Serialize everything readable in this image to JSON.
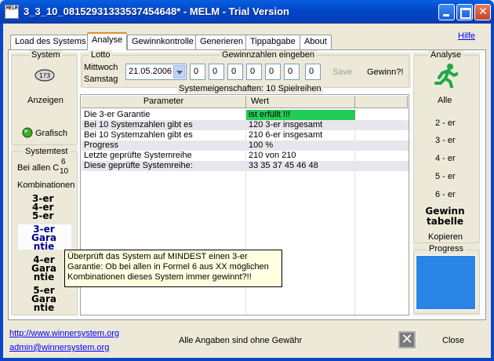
{
  "window": {
    "title": "3_3_10_08152931333537454648* - MELM - Trial Version",
    "icon_text": "MELM"
  },
  "tabs": [
    {
      "label": "Load des Systems",
      "active": false
    },
    {
      "label": "Analyse",
      "active": true
    },
    {
      "label": "Gewinnkontrolle",
      "active": false
    },
    {
      "label": "Generieren",
      "active": false
    },
    {
      "label": "Tippabgabe",
      "active": false
    },
    {
      "label": "About",
      "active": false
    }
  ],
  "help_link": "Hilfe",
  "left_panel": {
    "system_title": "System",
    "view_icon": "eye-123-icon",
    "anzeigen": "Anzeigen",
    "grafisch": "Grafisch",
    "systemtest_title": "Systemtest",
    "bei_allen": "Bei allen C",
    "c_top": "6",
    "c_bottom": "10",
    "kombinationen": "Kombinationen",
    "er_lines": [
      "3-er",
      "4-er",
      "5-er"
    ],
    "g3": [
      "3-er",
      "Gara",
      "ntie"
    ],
    "g4": [
      "4-er",
      "Gara",
      "ntie"
    ],
    "g5": [
      "5-er",
      "Gara",
      "ntie"
    ]
  },
  "lotto": {
    "title": "Lotto",
    "day1": "Mittwoch",
    "day2": "Samstag",
    "date": "21.05.2006",
    "gewinnzahlen_label": "Gewinnzahlen eingeben",
    "numbers": [
      "0",
      "0",
      "0",
      "0",
      "0",
      "0",
      "0"
    ],
    "save": "Save",
    "gewinn": "Gewinn?!"
  },
  "system_props_title": "Systemeigenschaften: 10 Spielreihen",
  "table": {
    "headers": [
      "Parameter",
      "Wert"
    ],
    "rows": [
      {
        "param": "Die 3-er Garantie",
        "value": "ist erfüllt !!!",
        "highlight": true
      },
      {
        "param": "Bei 10 Systemzahlen gibt es",
        "value": "120 3-er insgesamt"
      },
      {
        "param": "Bei 10 Systemzahlen gibt es",
        "value": "210 6-er insgesamt"
      },
      {
        "param": "Progress",
        "value": "100 %"
      },
      {
        "param": "Letzte geprüfte Systemreihe",
        "value": "210 von 210"
      },
      {
        "param": "Diese geprüfte Systemreihe:",
        "value": "33 35 37 45 46 48"
      }
    ]
  },
  "tooltip": "Überprüft das System auf MINDEST einen 3-er Garantie: Ob bei allen in Formel 6 aus XX möglichen Kombinationen dieses System immer gewinnt?!!",
  "right_panel": {
    "analyse_title": "Analyse",
    "runner_icon": "running-man-icon",
    "alle": "Alle",
    "items": [
      "2 - er",
      "3 - er",
      "4 - er",
      "5 - er",
      "6 - er"
    ],
    "gewinn": "Gewinn",
    "tabelle": "tabelle",
    "kopieren": "Kopieren",
    "progress_title": "Progress"
  },
  "footer": {
    "website": "http://www.winnersystem.org",
    "email": "admin@winnersystem.org",
    "disclaimer": "Alle Angaben sind ohne Gewähr",
    "close": "Close"
  },
  "colors": {
    "highlight_green": "#22cc55",
    "progress_blue": "#2a84e6",
    "runner_green": "#1fa84a"
  }
}
